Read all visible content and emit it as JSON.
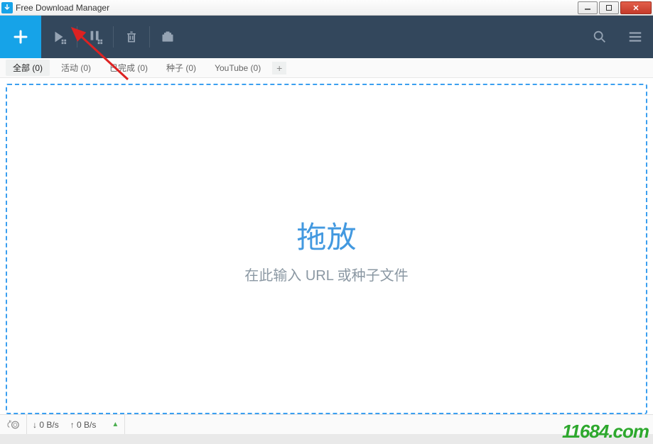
{
  "window": {
    "title": "Free Download Manager"
  },
  "tabs": [
    {
      "label": "全部 (0)",
      "active": true
    },
    {
      "label": "活动 (0)",
      "active": false
    },
    {
      "label": "已完成 (0)",
      "active": false
    },
    {
      "label": "种子 (0)",
      "active": false
    },
    {
      "label": "YouTube (0)",
      "active": false
    }
  ],
  "dropzone": {
    "title": "拖放",
    "subtitle": "在此输入 URL 或种子文件"
  },
  "status": {
    "download_speed": "0 B/s",
    "upload_speed": "0 B/s"
  },
  "watermark": "11684.com"
}
